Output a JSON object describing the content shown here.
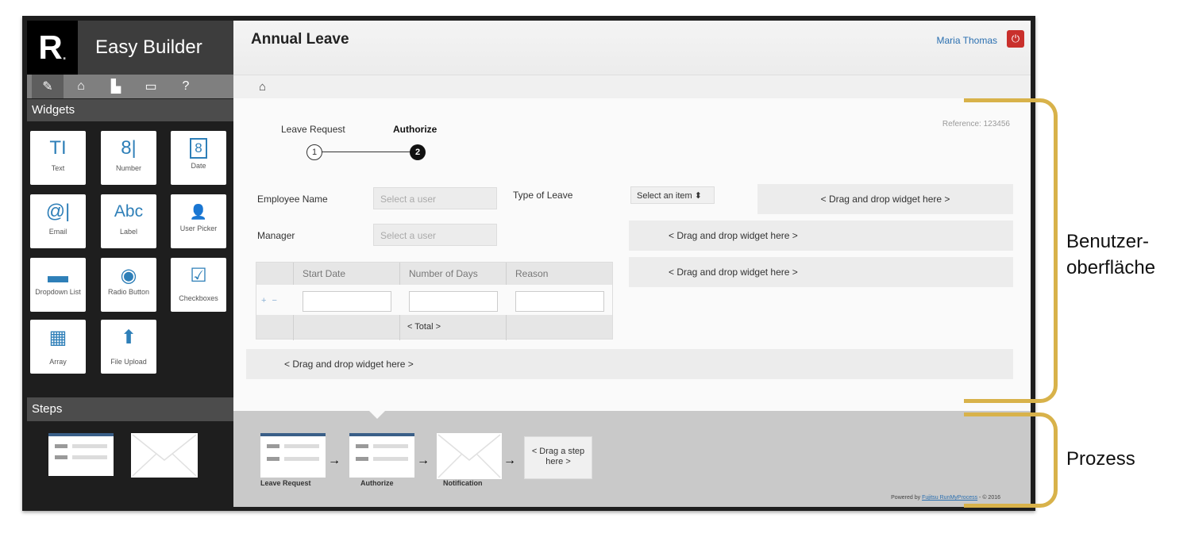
{
  "app": {
    "logo": "R",
    "logo_dot": ".",
    "title": "Easy Builder"
  },
  "sidebar": {
    "toolbar_icons": [
      "pencil-icon",
      "home-icon",
      "building-icon",
      "chat-icon",
      "help-icon"
    ],
    "widgets_header": "Widgets",
    "widgets": [
      {
        "label": "Text",
        "icon": "TI"
      },
      {
        "label": "Number",
        "icon": "8|"
      },
      {
        "label": "Date",
        "icon": "8"
      },
      {
        "label": "Email",
        "icon": "@|"
      },
      {
        "label": "Label",
        "icon": "Abc"
      },
      {
        "label": "User Picker",
        "icon": "👤"
      },
      {
        "label": "Dropdown List",
        "icon": "▬"
      },
      {
        "label": "Radio Button",
        "icon": "◉"
      },
      {
        "label": "Checkboxes",
        "icon": "☑"
      },
      {
        "label": "Array",
        "icon": "▦"
      },
      {
        "label": "File Upload",
        "icon": "⬆"
      }
    ],
    "steps_header": "Steps"
  },
  "header": {
    "title": "Annual Leave",
    "user": "Maria Thomas",
    "power_icon": "power-icon"
  },
  "breadcrumb": {
    "home_icon": "home-icon"
  },
  "wizard": {
    "steps": [
      {
        "label": "Leave Request",
        "number": "1",
        "active": false
      },
      {
        "label": "Authorize",
        "number": "2",
        "active": true
      }
    ]
  },
  "form": {
    "reference": "Reference: 123456",
    "employee_label": "Employee Name",
    "employee_placeholder": "Select a user",
    "manager_label": "Manager",
    "manager_placeholder": "Select a user",
    "leave_type_label": "Type of Leave",
    "leave_type_value": "Select an item ⬍",
    "dropzone_text": "< Drag and drop widget here >",
    "grid": {
      "headers": [
        "Start Date",
        "Number of Days",
        "Reason"
      ],
      "row_buttons": "+ −",
      "total": "< Total >"
    }
  },
  "process": {
    "steps": [
      "Leave Request",
      "Authorize",
      "Notification"
    ],
    "drop_text": "< Drag a step here >",
    "powered_prefix": "Powered by",
    "powered_link": "Fujitsu RunMyProcess",
    "powered_suffix": "- © 2016"
  },
  "annotations": {
    "ui": "Benutzer-\noberfläche",
    "process": "Prozess"
  },
  "colors": {
    "accent": "#2e7fb8",
    "bracket": "#d8b24a",
    "power": "#c9302c"
  }
}
